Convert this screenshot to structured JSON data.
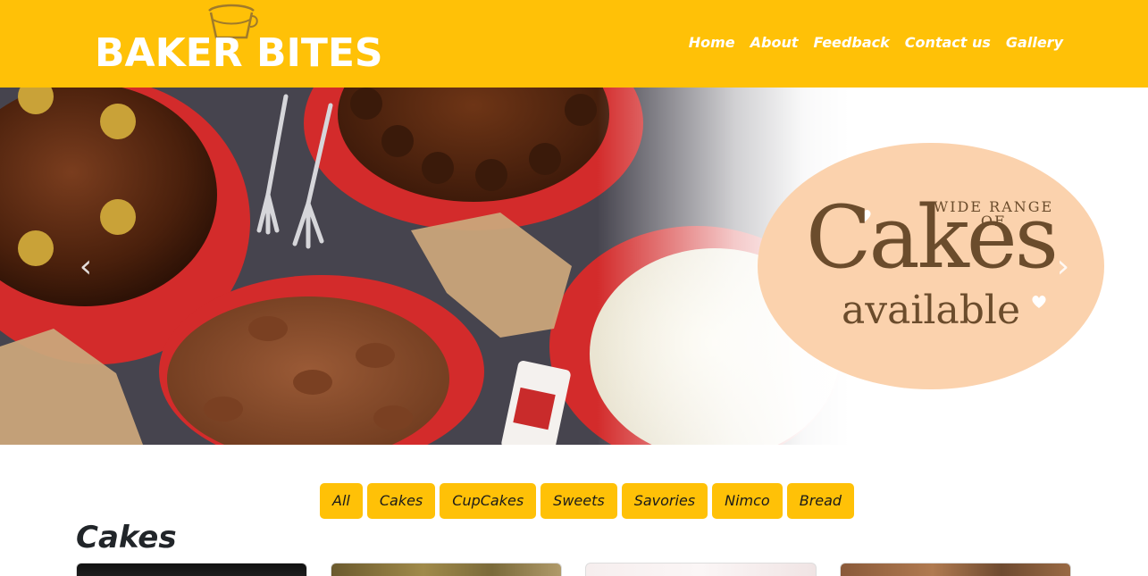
{
  "header": {
    "logo_text": "BAKER BITES",
    "logo_icon": "cake-cup-icon",
    "nav": [
      {
        "label": "Home"
      },
      {
        "label": "About"
      },
      {
        "label": "Feedback"
      },
      {
        "label": "Contact us"
      },
      {
        "label": "Gallery"
      }
    ]
  },
  "hero": {
    "promo_top": "Wide range of",
    "promo_main": "Cakes",
    "promo_sub": "available",
    "prev_icon": "chevron-left-icon",
    "next_icon": "chevron-right-icon"
  },
  "filters": [
    {
      "label": "All"
    },
    {
      "label": "Cakes"
    },
    {
      "label": "CupCakes"
    },
    {
      "label": "Sweets"
    },
    {
      "label": "Savories"
    },
    {
      "label": "Nimco"
    },
    {
      "label": "Bread"
    }
  ],
  "section": {
    "title": "Cakes"
  },
  "colors": {
    "brand_yellow": "#ffc107",
    "promo_peach": "#fbd2ad",
    "promo_brown": "#6b4c2c"
  }
}
